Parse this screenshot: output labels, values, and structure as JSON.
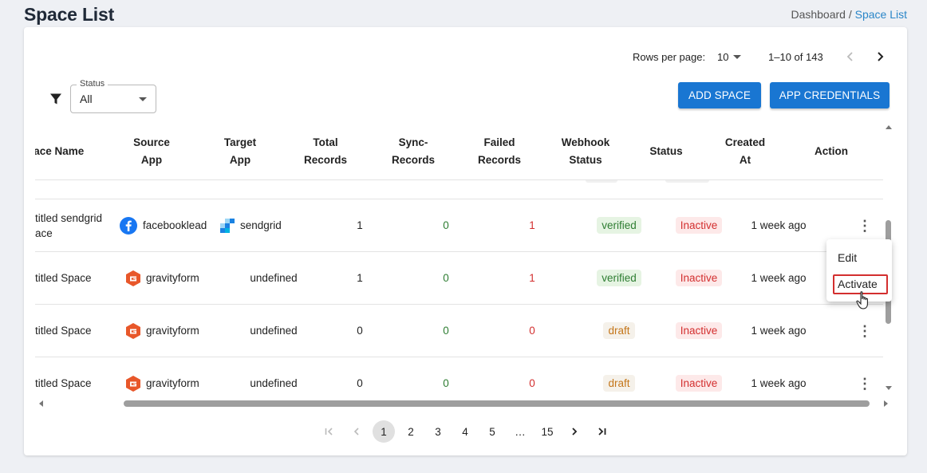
{
  "page": {
    "title": "Space List"
  },
  "breadcrumb": {
    "parent": "Dashboard",
    "separator": "/",
    "current": "Space List"
  },
  "top_pagination": {
    "rows_label": "Rows per page:",
    "rows_value": "10",
    "range": "1–10 of 143"
  },
  "filter": {
    "label": "Status",
    "value": "All"
  },
  "buttons": {
    "add_space": "ADD SPACE",
    "app_credentials": "APP CREDENTIALS"
  },
  "table": {
    "headers": {
      "name": "pace Name",
      "source": [
        "Source",
        "App"
      ],
      "target": [
        "Target",
        "App"
      ],
      "total": [
        "Total",
        "Records"
      ],
      "sync": [
        "Sync-",
        "Records"
      ],
      "failed": [
        "Failed",
        "Records"
      ],
      "webhook": [
        "Webhook",
        "Status"
      ],
      "status": "Status",
      "created": [
        "Created",
        "At"
      ],
      "action": "Action"
    },
    "rows": [
      {
        "name": [
          "titled sendgrid",
          "ace"
        ],
        "source": "facebooklead",
        "source_icon": "facebook-icon",
        "target": "sendgrid",
        "target_icon": "sendgrid-icon",
        "total": "1",
        "sync": "0",
        "failed": "1",
        "webhook": "verified",
        "status": "Inactive",
        "created": "1 week ago"
      },
      {
        "name": [
          "titled Space"
        ],
        "source": "gravityform",
        "source_icon": "gravityform-icon",
        "target": "undefined",
        "target_icon": "",
        "total": "1",
        "sync": "0",
        "failed": "1",
        "webhook": "verified",
        "status": "Inactive",
        "created": "1 week ago"
      },
      {
        "name": [
          "titled Space"
        ],
        "source": "gravityform",
        "source_icon": "gravityform-icon",
        "target": "undefined",
        "target_icon": "",
        "total": "0",
        "sync": "0",
        "failed": "0",
        "webhook": "draft",
        "status": "Inactive",
        "created": "1 week ago"
      },
      {
        "name": [
          "titled Space"
        ],
        "source": "gravityform",
        "source_icon": "gravityform-icon",
        "target": "undefined",
        "target_icon": "",
        "total": "0",
        "sync": "0",
        "failed": "0",
        "webhook": "draft",
        "status": "Inactive",
        "created": "1 week ago"
      }
    ]
  },
  "pagination": {
    "pages": [
      "1",
      "2",
      "3",
      "4",
      "5",
      "…",
      "15"
    ],
    "current": "1"
  },
  "action_menu": {
    "edit": "Edit",
    "activate": "Activate"
  },
  "colors": {
    "primary": "#1976d2",
    "success": "#2e7d32",
    "error": "#d32f2f",
    "draft": "#c4761a",
    "link": "#2a86c8",
    "facebook": "#1877f2",
    "gravityform": "#e8572a",
    "sendgrid": "#1a82e2"
  }
}
